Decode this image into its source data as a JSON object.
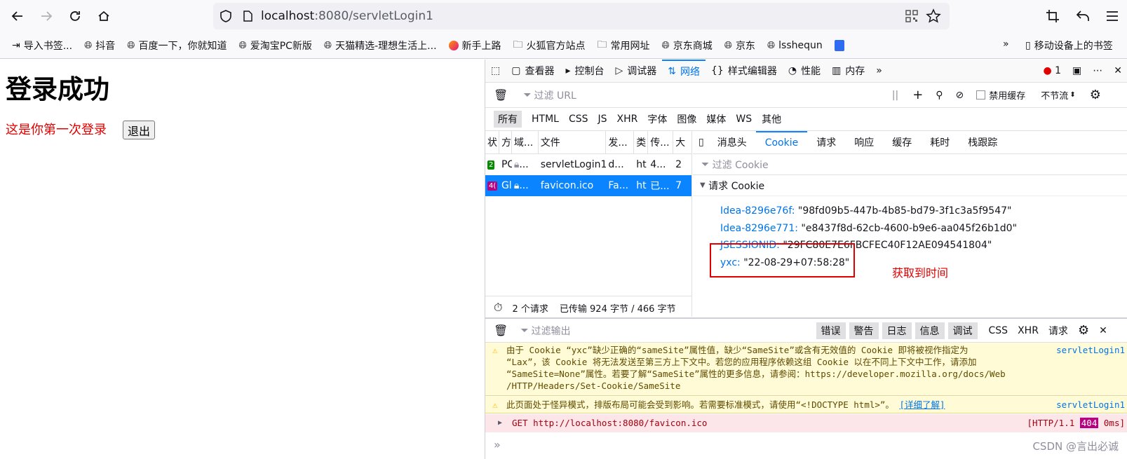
{
  "browser": {
    "url_host": "localhost",
    "url_rest": ":8080/servletLogin1"
  },
  "bookmarks": {
    "items": [
      {
        "label": "导入书签...",
        "icon": "import-icon"
      },
      {
        "label": "抖音",
        "icon": "globe-icon"
      },
      {
        "label": "百度一下，你就知道",
        "icon": "globe-icon"
      },
      {
        "label": "爱淘宝PC新版",
        "icon": "globe-icon"
      },
      {
        "label": "天猫精选-理想生活上...",
        "icon": "globe-icon"
      },
      {
        "label": "新手上路",
        "icon": "firefox-icon"
      },
      {
        "label": "火狐官方站点",
        "icon": "folder-icon"
      },
      {
        "label": "常用网址",
        "icon": "folder-icon"
      },
      {
        "label": "京东商城",
        "icon": "globe-icon"
      },
      {
        "label": "京东",
        "icon": "globe-icon"
      },
      {
        "label": "lsshequn",
        "icon": "globe-icon"
      }
    ],
    "mobile": "移动设备上的书签"
  },
  "page": {
    "heading": "登录成功",
    "message": "这是你第一次登录",
    "logout": "退出"
  },
  "devtools": {
    "tabs": [
      "查看器",
      "控制台",
      "调试器",
      "网络",
      "样式编辑器",
      "性能",
      "内存"
    ],
    "error_count": "1",
    "filter_url_placeholder": "过滤 URL",
    "disable_cache": "禁用缓存",
    "throttle": "不节流",
    "filter_types": [
      "所有",
      "HTML",
      "CSS",
      "JS",
      "XHR",
      "字体",
      "图像",
      "媒体",
      "WS",
      "其他"
    ],
    "columns": [
      "状",
      "方",
      "域...",
      "文件",
      "发...",
      "类",
      "传...",
      "大"
    ],
    "requests": [
      {
        "status": "2",
        "method": "PC",
        "domain": "...",
        "file": "servletLogin1",
        "initiator": "d...",
        "type": "ht",
        "transferred": "4...",
        "size": "2"
      },
      {
        "status": "4(",
        "method": "Gl",
        "domain": "...",
        "file": "favicon.ico",
        "initiator": "Fa...",
        "type": "ht",
        "transferred": "已...",
        "size": "7"
      }
    ],
    "status": {
      "count": "2 个请求",
      "transferred": "已传输 924 字节 / 466 字节"
    },
    "detail_tabs": [
      "消息头",
      "Cookie",
      "请求",
      "响应",
      "缓存",
      "耗时",
      "栈跟踪"
    ],
    "cookie_filter_placeholder": "过滤 Cookie",
    "cookie_section": "请求 Cookie",
    "cookies": [
      {
        "key": "Idea-8296e76f:",
        "value": "\"98fd09b5-447b-4b85-bd79-3f1c3a5f9547\""
      },
      {
        "key": "Idea-8296e771:",
        "value": "\"e8437f8d-62cb-4600-b9e6-aa045f26b1d0\""
      },
      {
        "key": "JSESSIONID:",
        "value": "\"29FC80E7E6FBCFEC40F12AE094541804\""
      },
      {
        "key": "yxc:",
        "value": "\"22-08-29+07:58:28\""
      }
    ],
    "annotation": "获取到时间"
  },
  "console": {
    "filter_placeholder": "过滤输出",
    "levels": [
      "错误",
      "警告",
      "日志",
      "信息",
      "调试"
    ],
    "types": [
      "CSS",
      "XHR",
      "请求"
    ],
    "messages": {
      "warn1_lines": [
        "由于 Cookie “yxc”缺少正确的“sameSite”属性值，缺少“SameSite”或含有无效值的 Cookie 即将被视作指定为",
        "“Lax”，该 Cookie 将无法发送至第三方上下文中。若您的应用程序依赖这组 Cookie 以在不同上下文中工作，请添加",
        "“SameSite=None”属性。若要了解“SameSite”属性的更多信息，请参阅：https://developer.mozilla.org/docs/Web",
        "/HTTP/Headers/Set-Cookie/SameSite"
      ],
      "warn1_source": "servletLogin1",
      "warn2": "此页面处于怪异模式，排版布局可能会受到影响。若需要标准模式，请使用“<!DOCTYPE html>”。",
      "warn2_link": "[详细了解]",
      "warn2_source": "servletLogin1",
      "err_text": "GET http://localhost:8080/favicon.ico",
      "err_status_pre": "[HTTP/1.1",
      "err_code": "404",
      "err_time": "0ms]"
    }
  },
  "watermark": "CSDN @言出必诚",
  "colors": {
    "accent": "#0a84ff",
    "error": "#e00000"
  }
}
